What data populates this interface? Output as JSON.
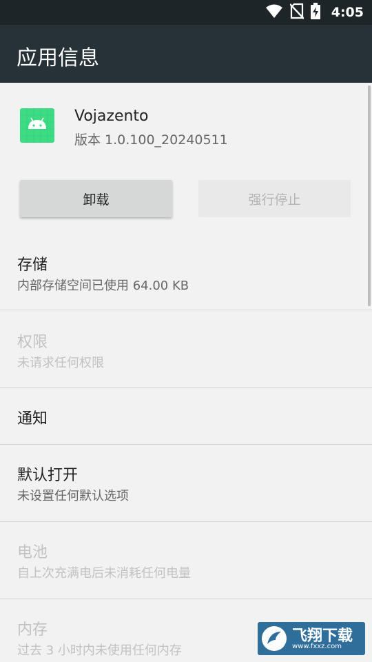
{
  "status_bar": {
    "time": "4:05",
    "icons": [
      "wifi-icon",
      "no-sim-icon",
      "battery-charging-icon"
    ]
  },
  "app_bar": {
    "title": "应用信息"
  },
  "app": {
    "name": "Vojazento",
    "version": "版本 1.0.100_20240511",
    "icon": "android-app-icon",
    "icon_color": "#3ddc84"
  },
  "buttons": {
    "uninstall_label": "卸载",
    "force_stop_label": "强行停止"
  },
  "prefs": [
    {
      "title": "存储",
      "summary": "内部存储空间已使用 64.00 KB",
      "enabled": true
    },
    {
      "title": "权限",
      "summary": "未请求任何权限",
      "enabled": false
    },
    {
      "title": "通知",
      "summary": "",
      "enabled": true
    },
    {
      "title": "默认打开",
      "summary": "未设置任何默认选项",
      "enabled": true
    },
    {
      "title": "电池",
      "summary": "自上次充满电后未消耗任何电量",
      "enabled": false
    },
    {
      "title": "内存",
      "summary": "过去 3 小时内未使用任何内存",
      "enabled": false
    }
  ],
  "watermark": {
    "text": "飞翔下载",
    "url": "www.fxxz.com"
  },
  "colors": {
    "app_bar": "#263238",
    "status_bar": "#1e2528",
    "background": "#f2f2f2"
  }
}
